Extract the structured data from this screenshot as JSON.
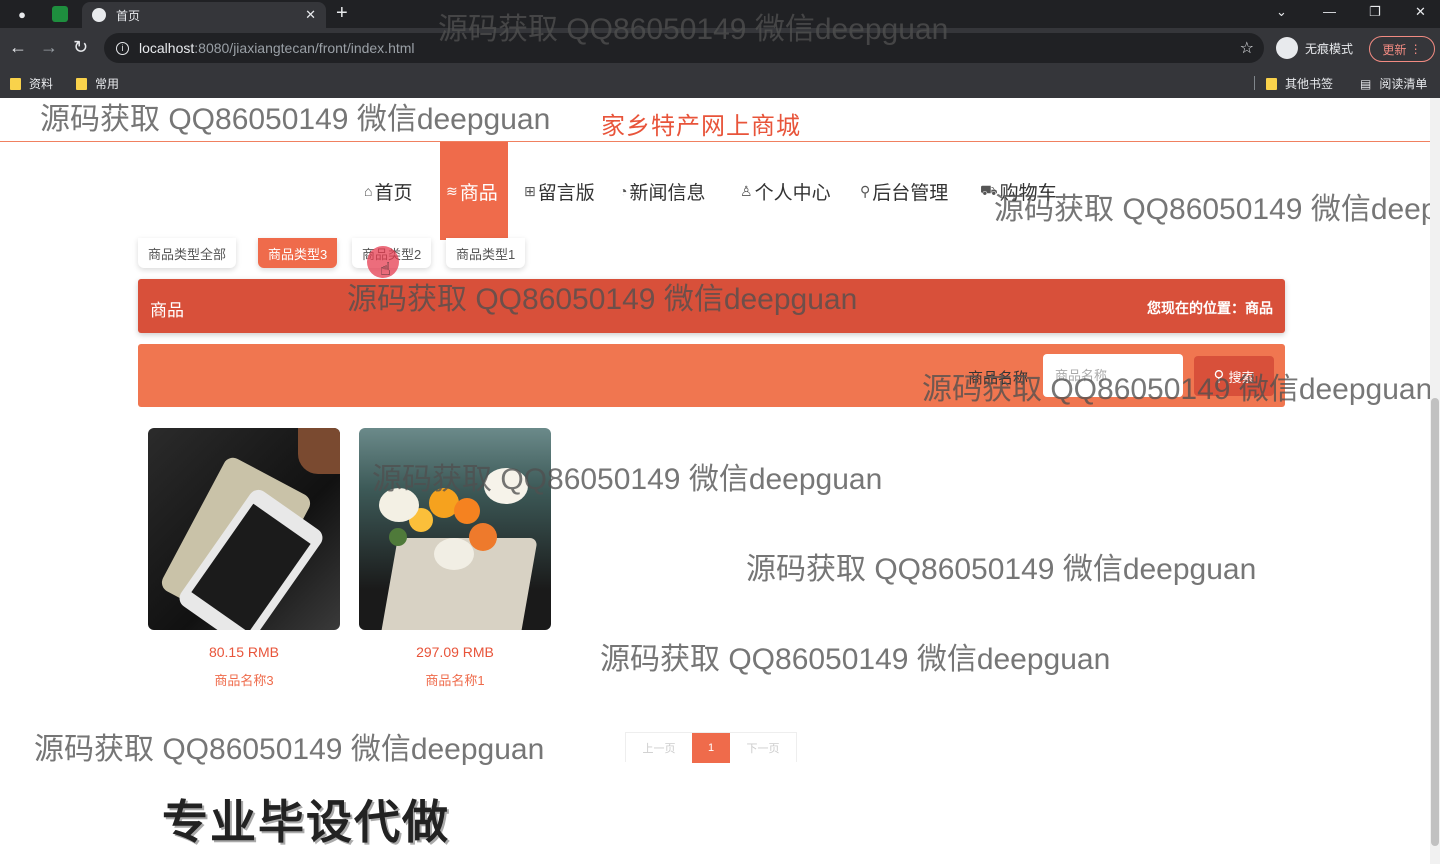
{
  "browser": {
    "tab_title": "首页",
    "url_host": "localhost",
    "url_rest": ":8080/jiaxiangtecan/front/index.html",
    "incognito_label": "无痕模式",
    "update_label": "更新",
    "bookmarks": [
      "资料",
      "常用"
    ],
    "bookmarks_right": [
      "其他书签",
      "阅读清单"
    ]
  },
  "site": {
    "title": "家乡特产网上商城"
  },
  "nav": {
    "items": [
      {
        "label": "首页",
        "icon": "home-icon"
      },
      {
        "label": "商品",
        "icon": "layers-icon"
      },
      {
        "label": "留言版",
        "icon": "gift-icon"
      },
      {
        "label": "新闻信息",
        "icon": "dashboard-icon"
      },
      {
        "label": "个人中心",
        "icon": "user-icon"
      },
      {
        "label": "后台管理",
        "icon": "link-icon"
      },
      {
        "label": "购物车",
        "icon": "cart-icon"
      }
    ],
    "active": "商品"
  },
  "categories": [
    "商品类型全部",
    "商品类型3",
    "商品类型2",
    "商品类型1"
  ],
  "active_category": "商品类型3",
  "breadcrumb": {
    "title": "商品",
    "position": "您现在的位置：商品"
  },
  "search": {
    "label": "商品名称",
    "placeholder": "商品名称",
    "button": "搜索"
  },
  "products": [
    {
      "price": "80.15 RMB",
      "name": "商品名称3"
    },
    {
      "price": "297.09 RMB",
      "name": "商品名称1"
    }
  ],
  "pagination": {
    "prev": "上一页",
    "current": "1",
    "next": "下一页"
  },
  "promo": "专业毕设代做",
  "watermark": "源码获取 QQ86050149 微信deepguan",
  "colors": {
    "accent": "#ef6b4b",
    "accent_dark": "#d8503a",
    "search_bg": "#f07650"
  }
}
